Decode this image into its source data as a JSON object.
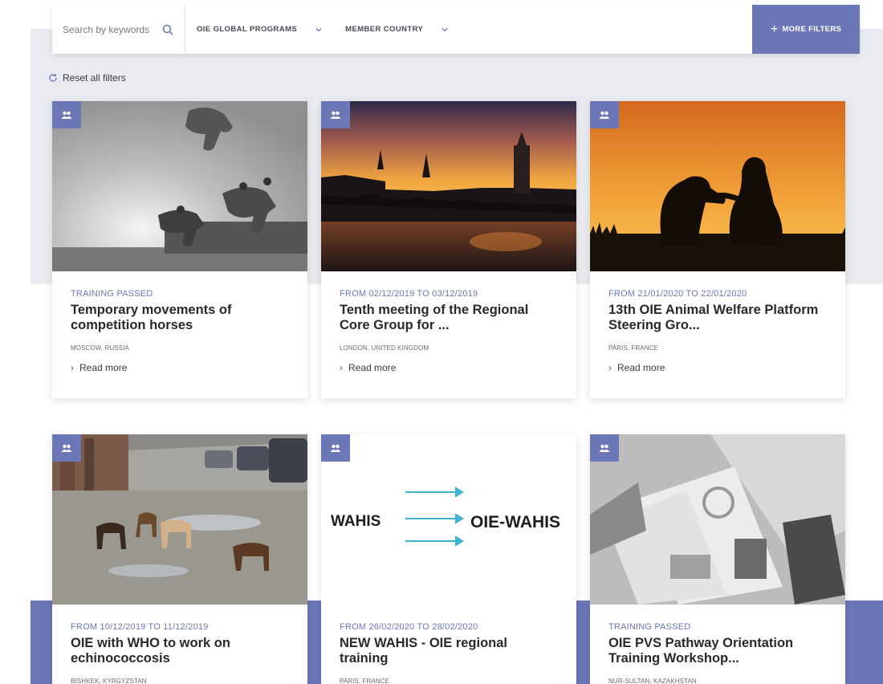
{
  "filters": {
    "search_placeholder": "Search by keywords",
    "programs_label": "OIE GLOBAL PROGRAMS",
    "country_label": "MEMBER COUNTRY",
    "more_filters_label": "MORE FILTERS",
    "more_filters_icon": "+",
    "reset_label": "Reset all filters"
  },
  "colors": {
    "accent": "#6c77b8",
    "page_gray": "#e9ebf0"
  },
  "cards": [
    {
      "date": "TRAINING PASSED",
      "title": "Temporary movements of competition horses",
      "location": "MOSCOW, RUSSIA",
      "read_more": "Read more",
      "image": "horse-racing-silhouette"
    },
    {
      "date": "FROM 02/12/2019 TO 03/12/2019",
      "title": "Tenth meeting of the Regional Core Group for ...",
      "location": "LONDON, UNITED KINGDOM",
      "read_more": "Read more",
      "image": "westminster-sunset"
    },
    {
      "date": "FROM 21/01/2020 TO 22/01/2020",
      "title": "13th OIE Animal Welfare Platform Steering Gro...",
      "location": "PARIS, FRANCE",
      "read_more": "Read more",
      "image": "woman-dog-silhouette"
    },
    {
      "date": "FROM 10/12/2019 TO 11/12/2019",
      "title": "OIE with WHO to work on echinococcosis",
      "location": "BISHKEK, KYRGYZSTAN",
      "image": "stray-dogs-street"
    },
    {
      "date": "FROM 26/02/2020 TO 28/02/2020",
      "title": "NEW WAHIS - OIE regional training",
      "location": "PARIS, FRANCE",
      "image": "wahis-diagram",
      "image_text_left": "WAHIS",
      "image_text_right": "OIE-WAHIS"
    },
    {
      "date": "TRAINING PASSED",
      "title": "OIE PVS Pathway Orientation Training Workshop...",
      "location": "NUR-SULTAN, KAZAKHSTAN",
      "image": "documents-grayscale"
    }
  ]
}
